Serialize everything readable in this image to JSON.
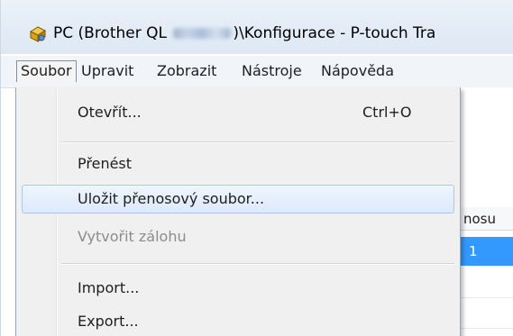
{
  "window": {
    "title_prefix": "PC (Brother QL ",
    "title_suffix": ")\\Konfigurace - P-touch Tra",
    "app_icon": "printer-tool-icon"
  },
  "menubar": {
    "items": [
      {
        "label": "Soubor",
        "active": true
      },
      {
        "label": "Upravit"
      },
      {
        "label": "Zobrazit"
      },
      {
        "label": "Nástroje"
      },
      {
        "label": "Nápověda"
      }
    ]
  },
  "file_menu": {
    "items": [
      {
        "label": "Otevřít...",
        "shortcut": "Ctrl+O"
      },
      {
        "label": "Přenést"
      },
      {
        "label": "Uložit přenosový soubor...",
        "highlighted": true
      },
      {
        "label": "Vytvořit zálohu",
        "disabled": true
      },
      {
        "label": "Import..."
      },
      {
        "label": "Export..."
      }
    ]
  },
  "background_grid": {
    "header_fragment": "nosu",
    "selected_row_fragment": "1"
  },
  "colors": {
    "selection": "#3399ff",
    "menu_highlight_border": "#a8c8ee",
    "disabled_text": "#8c8c8c"
  }
}
